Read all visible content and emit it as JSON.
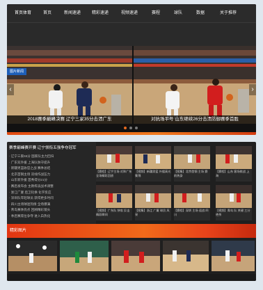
{
  "nav": {
    "items": [
      "首页体育",
      "首页",
      "新闻速递",
      "精彩速递",
      "视频速递",
      "赛程",
      "球队",
      "数据",
      "关于推荐"
    ]
  },
  "banner": {
    "badge": "图片新闻",
    "slides": [
      {
        "caption": "2018赛季巅峰决赛 辽宁三家35分击溃广东"
      },
      {
        "caption": "对抗场平号 山东继续26分击溃防御赛季首胜"
      }
    ],
    "prev_icon": "‹",
    "next_icon": "›"
  },
  "news": {
    "headline": "赛季巅峰赛开赛 辽宁领衔五强争夺冠军",
    "items": [
      "· 辽宁三家55分 国家队主力回归",
      "· 广东双外援 上海队防守提升",
      "· 新疆男篮收官之战 赛季总结",
      "· 北京首钢主场 双线作战压力",
      "· 山东新外援 首秀得分21分",
      "· 赛后发布会 主教练谈战术调整",
      "· 浙江广厦 后卫轮换 化学反应",
      "· 深圳队年轻球员 获得更多时间",
      "· 四川主场球迷热情 全场爆满",
      "· 青岛赛季亮点 回顾精彩镜头",
      "· 季后赛席位争夺 进入白热化"
    ]
  },
  "thumbs": [
    {
      "text": "【赛程】辽宁主场 对阵广东 全场精彩回放"
    },
    {
      "text": "【视频】新疆男篮 外援高光 集锦"
    },
    {
      "text": "【图集】北京首钢 主场 赛前热身"
    },
    {
      "text": "【赛程】山东 客场挑战 上海"
    },
    {
      "text": "【视频】广东队 快攻 反击 精彩瞬间"
    },
    {
      "text": "【图集】浙江 广厦 球员 风采"
    },
    {
      "text": "【赛程】深圳 主场 迎战 四川"
    },
    {
      "text": "【视频】青岛 队 关键 三分 绝杀"
    }
  ],
  "gallery": {
    "label": "精彩图片"
  }
}
